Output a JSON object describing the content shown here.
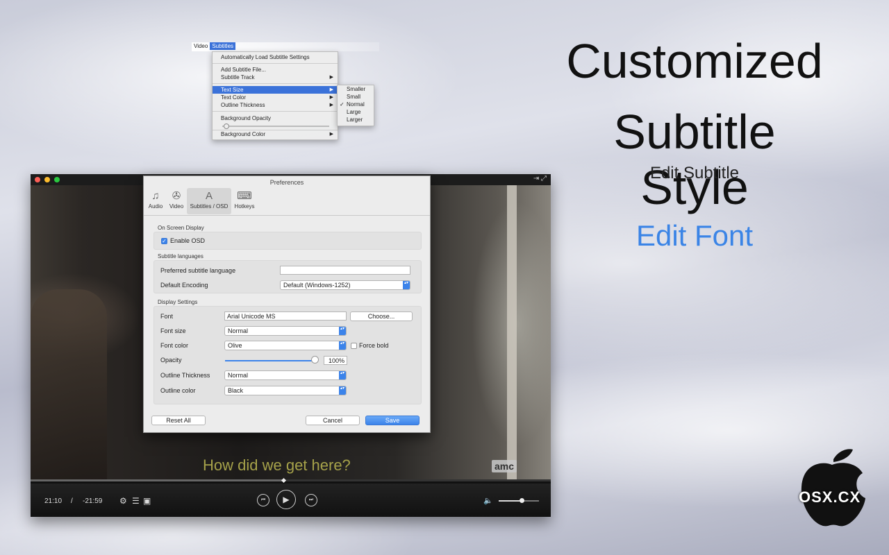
{
  "menubar": {
    "items": [
      "Video",
      "Subtitles"
    ],
    "active": "Subtitles"
  },
  "subtitles_menu": {
    "items": [
      {
        "label": "Automatically Load Subtitle Settings",
        "submenu": false
      },
      {
        "label": "Add Subtitle File...",
        "submenu": false
      },
      {
        "label": "Subtitle Track",
        "submenu": true
      },
      {
        "label": "Text Size",
        "submenu": true,
        "highlighted": true
      },
      {
        "label": "Text Color",
        "submenu": true
      },
      {
        "label": "Outline Thickness",
        "submenu": true
      },
      {
        "label": "Background Opacity",
        "submenu": false
      },
      {
        "label": "Background Color",
        "submenu": true
      }
    ],
    "background_opacity": 0.03
  },
  "text_size_submenu": {
    "items": [
      "Smaller",
      "Small",
      "Normal",
      "Large",
      "Larger"
    ],
    "checked": "Normal",
    "check_glyph": "✓"
  },
  "headline": {
    "line1": "Customized",
    "line2": "Subtitle Style",
    "sub": "Edit Subtitle",
    "feature": "Edit Font",
    "feature_color": "#3a84e6"
  },
  "player": {
    "subtitle_text": "How did we get here?",
    "subtitle_color": "#a6a24a",
    "channel_logo": "amc",
    "elapsed": "21:10",
    "separator": "/",
    "remaining": "-21:59",
    "progress": 0.49,
    "volume": 0.52,
    "icons": {
      "settings": "⚙",
      "playlist": "☰",
      "snapshot": "▣",
      "prev": "⏮",
      "play": "▶",
      "next": "⏭",
      "volume": "🔈",
      "pin": "⇥",
      "fullscreen": "⤢"
    }
  },
  "preferences": {
    "title": "Preferences",
    "tabs": [
      {
        "label": "Audio",
        "icon": "audio-icon"
      },
      {
        "label": "Video",
        "icon": "film-reel-icon"
      },
      {
        "label": "Subtitles / OSD",
        "icon": "text-icon",
        "selected": true
      },
      {
        "label": "Hotkeys",
        "icon": "keyboard-icon"
      }
    ],
    "osd": {
      "section": "On Screen Display",
      "enable_label": "Enable OSD",
      "enabled": true,
      "check_glyph": "✓"
    },
    "languages": {
      "section": "Subtitle languages",
      "preferred_label": "Preferred subtitle language",
      "preferred_value": "",
      "encoding_label": "Default Encoding",
      "encoding_value": "Default (Windows-1252)"
    },
    "display": {
      "section": "Display Settings",
      "font_label": "Font",
      "font_value": "Arial Unicode MS",
      "choose_label": "Choose...",
      "size_label": "Font size",
      "size_value": "Normal",
      "color_label": "Font color",
      "color_value": "Olive",
      "force_bold_label": "Force bold",
      "force_bold": false,
      "opacity_label": "Opacity",
      "opacity_value": "100%",
      "outline_thickness_label": "Outline Thickness",
      "outline_thickness_value": "Normal",
      "outline_color_label": "Outline color",
      "outline_color_value": "Black"
    },
    "buttons": {
      "reset": "Reset All",
      "cancel": "Cancel",
      "save": "Save"
    },
    "stepper_glyph": "▴▾"
  },
  "logo": {
    "text": "OSX.CX"
  }
}
